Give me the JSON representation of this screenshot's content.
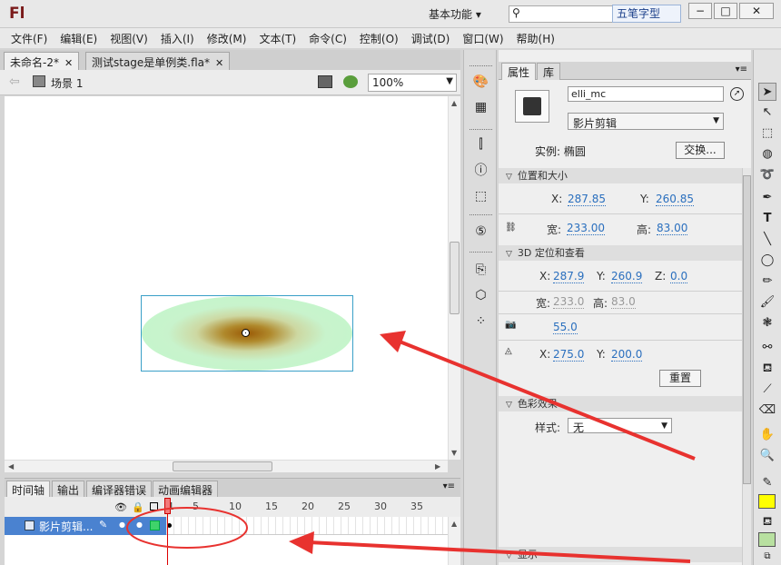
{
  "app": {
    "logo": "Fl",
    "workspace": "基本功能",
    "search_placeholder": "",
    "ime_label": "五笔字型",
    "window_buttons": [
      "minimize-icon",
      "maximize-icon",
      "close-icon"
    ]
  },
  "menu": [
    "文件(F)",
    "编辑(E)",
    "视图(V)",
    "插入(I)",
    "修改(M)",
    "文本(T)",
    "命令(C)",
    "控制(O)",
    "调试(D)",
    "窗口(W)",
    "帮助(H)"
  ],
  "doc_tabs": [
    {
      "label": "未命名-2*",
      "active": true
    },
    {
      "label": "测试stage是单例类.fla*",
      "active": false
    }
  ],
  "scene": {
    "label": "场景 1",
    "zoom": "100%"
  },
  "timeline": {
    "tabs": [
      "时间轴",
      "输出",
      "编译器错误",
      "动画编辑器"
    ],
    "frame_numbers": [
      "1",
      "5",
      "10",
      "15",
      "20",
      "25",
      "30",
      "35"
    ],
    "layer_name": "影片剪辑..."
  },
  "properties": {
    "tabs": [
      "属性",
      "库"
    ],
    "instance_name": "elli_mc",
    "symbol_type": "影片剪辑",
    "instance_of_label": "实例:",
    "instance_of_value": "椭圆",
    "swap_label": "交换...",
    "sections": {
      "position_size": "位置和大小",
      "three_d": "3D 定位和查看",
      "color_effect": "色彩效果",
      "display": "显示"
    },
    "x_label": "X:",
    "y_label": "Y:",
    "z_label": "Z:",
    "x": "287.85",
    "y": "260.85",
    "width_label": "宽:",
    "height_label": "高:",
    "width": "233.00",
    "height": "83.00",
    "x3d": "287.9",
    "y3d": "260.9",
    "z3d": "0.0",
    "width3d": "233.0",
    "height3d": "83.0",
    "perspective": "55.0",
    "vanish_x": "275.0",
    "vanish_y": "200.0",
    "reset_label": "重置",
    "style_label": "样式:",
    "style_value": "无"
  },
  "colors": {
    "stroke_swatch": "#ffff00",
    "fill_swatch": "#b8e0a0",
    "annotation": "#e8322f",
    "selection_box": "#3aa0c8",
    "layer_highlight": "#4a82d0"
  }
}
